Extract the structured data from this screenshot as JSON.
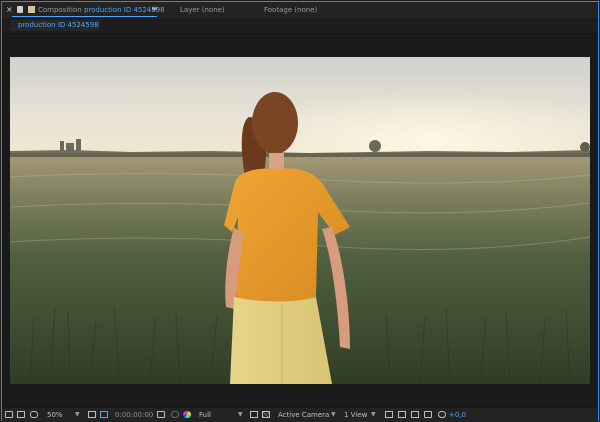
{
  "tabs": {
    "composition_prefix": "Composition",
    "composition_name": "production ID 4524598",
    "layer": "Layer (none)",
    "footage": "Footage (none)",
    "close_glyph": "×",
    "menu_glyph": "≡"
  },
  "subtab": {
    "label": "production ID 4524598"
  },
  "statusbar": {
    "zoom": "50%",
    "timecode": "0:00:00:00",
    "resolution": "Full",
    "camera": "Active Camera",
    "views": "1 View",
    "exposure": "+0,0"
  },
  "colors": {
    "accent": "#4aa7ff",
    "panel_border": "#2d8ceb",
    "background": "#1d1d1d"
  },
  "icons": [
    "close-icon",
    "lock-icon",
    "menu-icon",
    "region-icon",
    "monitor-icon",
    "mask-icon",
    "grid-icon",
    "snapshot-icon",
    "color-wheel-icon",
    "transparency-grid-icon",
    "3d-view-icon",
    "fast-preview-icon",
    "flowchart-icon",
    "reset-exposure-icon"
  ]
}
